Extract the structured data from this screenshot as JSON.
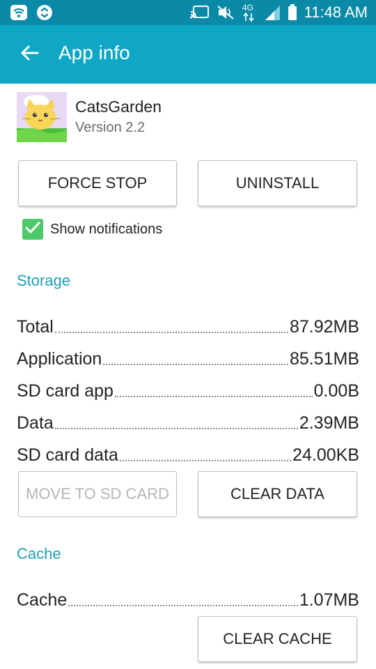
{
  "status_bar": {
    "time": "11:48 AM",
    "network": "4G"
  },
  "app_bar": {
    "title": "App info"
  },
  "app": {
    "name": "CatsGarden",
    "version": "Version 2.2"
  },
  "actions": {
    "force_stop": "FORCE STOP",
    "uninstall": "UNINSTALL"
  },
  "notifications": {
    "label": "Show notifications",
    "checked": true
  },
  "storage": {
    "header": "Storage",
    "rows": [
      {
        "label": "Total",
        "value": "87.92MB"
      },
      {
        "label": "Application",
        "value": "85.51MB"
      },
      {
        "label": "SD card app",
        "value": "0.00B"
      },
      {
        "label": "Data",
        "value": "2.39MB"
      },
      {
        "label": "SD card data",
        "value": "24.00KB"
      }
    ],
    "move_to_sd": "MOVE TO SD CARD",
    "clear_data": "CLEAR DATA"
  },
  "cache": {
    "header": "Cache",
    "rows": [
      {
        "label": "Cache",
        "value": "1.07MB"
      }
    ],
    "clear_cache": "CLEAR CACHE"
  },
  "colors": {
    "status_bar": "#0a8aa6",
    "app_bar": "#0fa7c5",
    "accent": "#1d9fb5",
    "checkbox": "#4dc96a"
  }
}
